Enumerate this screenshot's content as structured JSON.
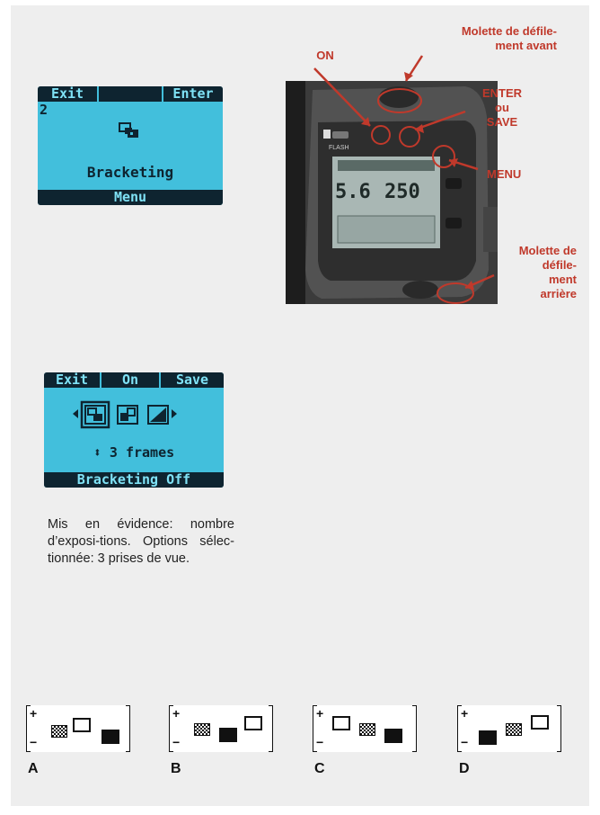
{
  "lcd_top": {
    "left_button": "Exit",
    "right_button": "Enter",
    "number": "2",
    "title": "Bracketing",
    "footer": "Menu"
  },
  "camera_labels": {
    "on": "ON",
    "front_dial": "Molette de défile-\nment avant",
    "enter": "ENTER\nou\nSAVE",
    "menu": "MENU",
    "rear_dial": "Molette de\ndéfile-\nment\narrière"
  },
  "camera_display": {
    "aperture": "5.6",
    "shutter": "250",
    "flash_label": "FLASH"
  },
  "lcd_bottom": {
    "left_button": "Exit",
    "middle_button": "On",
    "right_button": "Save",
    "frames": "3 frames",
    "footer": "Bracketing Off"
  },
  "caption": "Mis en évidence: nombre d’exposi-tions. Options sélec-tionnée: 3 prises de vue.",
  "bracket_variants": [
    {
      "letter": "A"
    },
    {
      "letter": "B"
    },
    {
      "letter": "C"
    },
    {
      "letter": "D"
    }
  ],
  "colors": {
    "lcd_bg": "#42bfdc",
    "lcd_dark": "#0e2430",
    "accent_red": "#c0392b",
    "panel_bg": "#eeeeee"
  }
}
